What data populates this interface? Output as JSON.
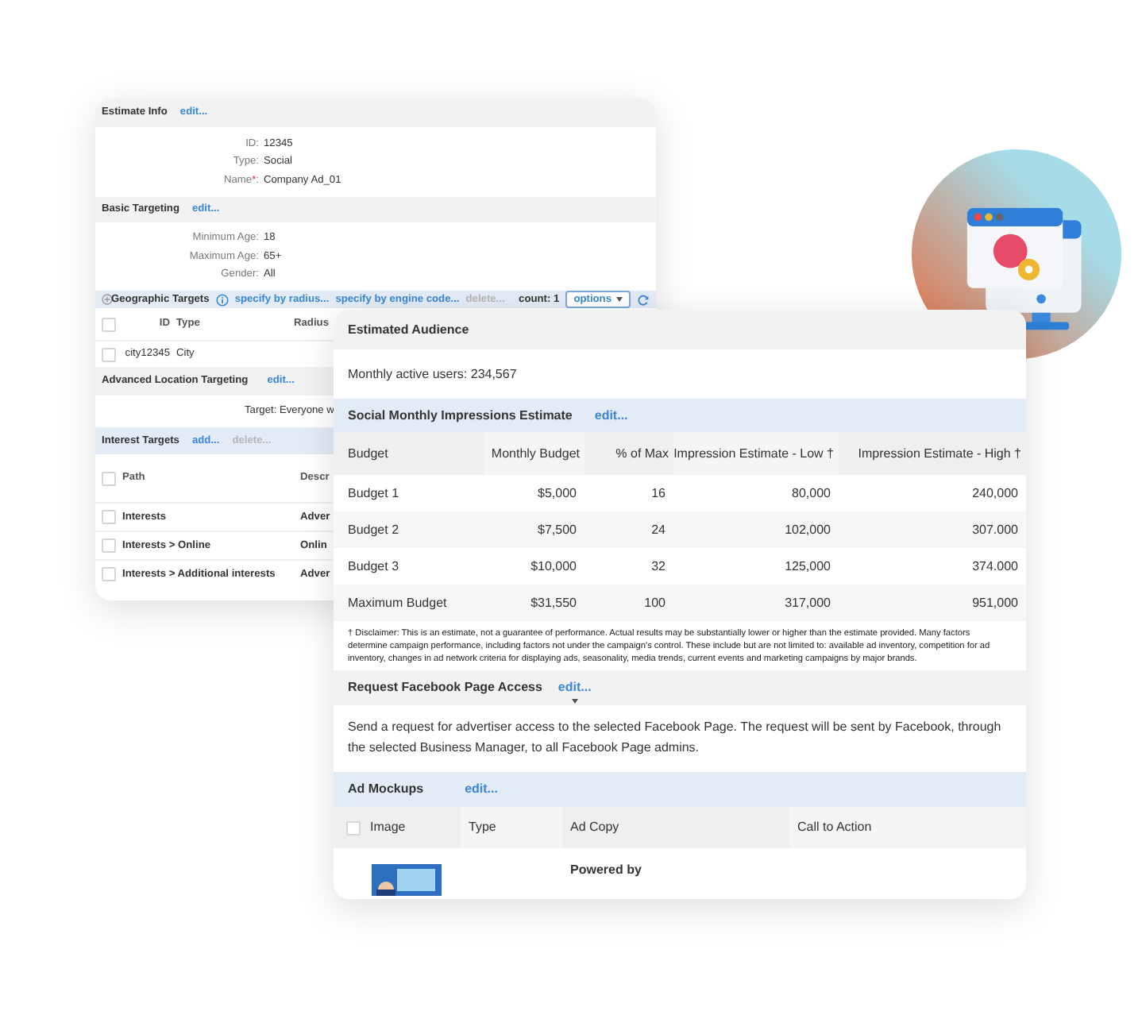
{
  "estimate_window": {
    "estimate_info": {
      "title": "Estimate Info",
      "link": "edit...",
      "fields": [
        {
          "label": "ID:",
          "value": "12345"
        },
        {
          "label": "Type:",
          "value": "Social"
        },
        {
          "label": "Name",
          "required_mark": "*",
          "label_end": ":",
          "value": "Company Ad_01"
        }
      ]
    },
    "basic_targeting": {
      "title": "Basic Targeting",
      "link": "edit...",
      "fields": [
        {
          "label": "Minimum Age:",
          "value": "18"
        },
        {
          "label": "Maximum Age:",
          "value": "65+"
        },
        {
          "label": "Gender:",
          "value": "All"
        }
      ]
    },
    "geographic_targets": {
      "title": "Geographic Targets",
      "links": [
        {
          "text": "specify by radius...",
          "disabled": false
        },
        {
          "text": "specify by engine code...",
          "disabled": false
        },
        {
          "text": "delete...",
          "disabled": true
        }
      ],
      "count": "count: 1",
      "options_button": "options",
      "all_checked": false,
      "columns": [
        "ID",
        "Type",
        "Radius"
      ],
      "rows": [
        {
          "checked": false,
          "cells": [
            "city12345",
            "City"
          ]
        }
      ]
    },
    "advanced_location": {
      "title": "Advanced Location Targeting",
      "link": "edit...",
      "target": "Target: Everyone w"
    },
    "interest_targets": {
      "title": "Interest Targets",
      "links": [
        {
          "text": "add...",
          "disabled": false
        },
        {
          "text": "delete...",
          "disabled": true
        }
      ],
      "all_checked": false,
      "columns": [
        "Path",
        "Descr"
      ],
      "rows": [
        {
          "checked": false,
          "cells": [
            "Interests",
            "Adver"
          ]
        },
        {
          "checked": false,
          "cells": [
            "Interests > Online",
            "Onlin"
          ]
        },
        {
          "checked": false,
          "cells": [
            "Interests > Additional interests",
            "Adver"
          ]
        }
      ]
    }
  },
  "audience_window": {
    "estimated_audience": {
      "title": "Estimated Audience",
      "text": "Monthly active users: 234,567"
    },
    "impressions": {
      "title": "Social Monthly Impressions Estimate",
      "link": "edit...",
      "columns": [
        "Budget",
        "Monthly Budget",
        "% of Max",
        "Impression Estimate - Low †",
        "Impression Estimate - High †"
      ],
      "rows": [
        [
          "Budget 1",
          "$5,000",
          "16",
          "80,000",
          "240,000"
        ],
        [
          "Budget 2",
          "$7,500",
          "24",
          "102,000",
          "307.000"
        ],
        [
          "Budget 3",
          "$10,000",
          "32",
          "125,000",
          "374.000"
        ],
        [
          "Maximum Budget",
          "$31,550",
          "100",
          "317,000",
          "951,000"
        ]
      ]
    },
    "disclaimer": "† Disclaimer: This is an estimate, not a guarantee of performance. Actual results may be substantially lower or higher than the estimate provided. Many factors determine campaign performance, including factors not under the campaign's control. These include but are not limited to: available ad inventory, competition for ad inventory, changes in ad network criteria for displaying ads, seasonality, media trends, current events and marketing campaigns by major brands.",
    "facebook_access": {
      "title": "Request Facebook Page Access",
      "link": "edit...",
      "text": "Send a request for advertiser access to the selected Facebook Page. The request will be sent by Facebook, through the selected Business Manager, to all Facebook Page admins."
    },
    "ad_mockups": {
      "title": "Ad Mockups",
      "link": "edit...",
      "all_checked": false,
      "columns": [
        "Image",
        "Type",
        "Ad Copy",
        "Call to Action"
      ],
      "rows": [
        {
          "kind": "picture",
          "ad_copy": "Powered by"
        }
      ]
    }
  }
}
